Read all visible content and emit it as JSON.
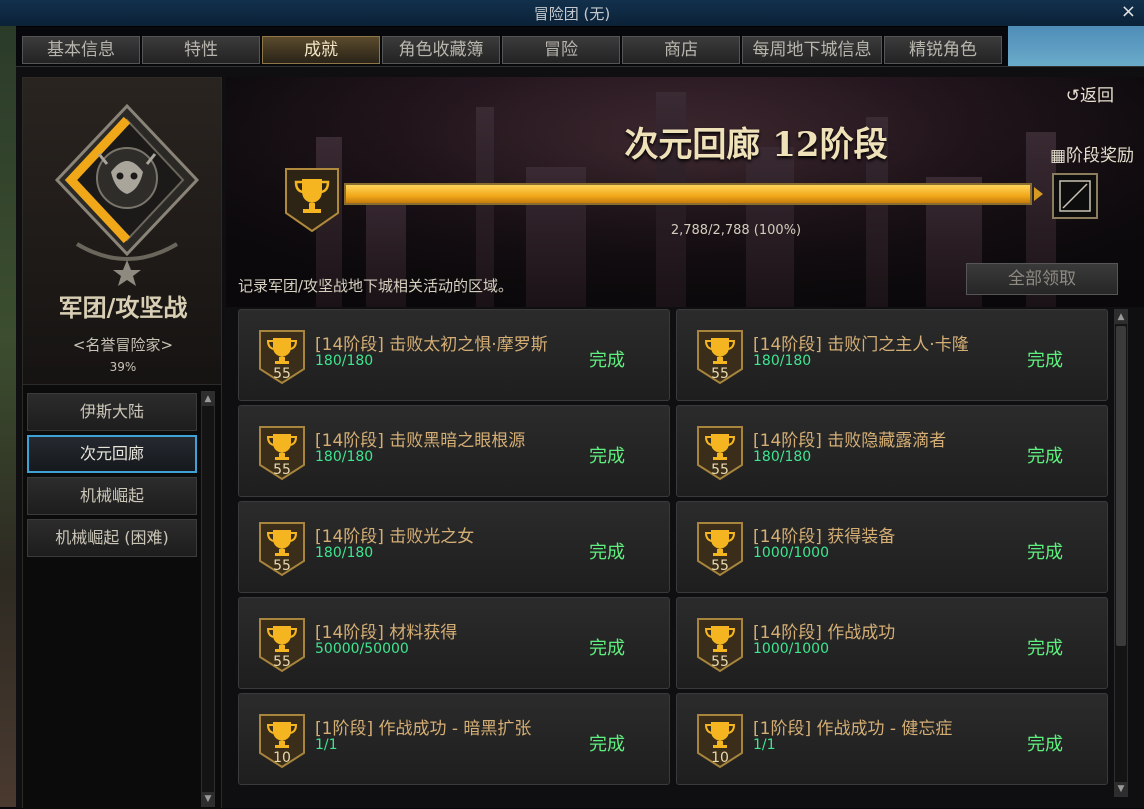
{
  "window": {
    "title": "冒险团 (无)",
    "close_label": "×"
  },
  "tabs": [
    {
      "label": "基本信息",
      "active": false
    },
    {
      "label": "特性",
      "active": false
    },
    {
      "label": "成就",
      "active": true
    },
    {
      "label": "角色收藏簿",
      "active": false
    },
    {
      "label": "冒险",
      "active": false
    },
    {
      "label": "商店",
      "active": false
    },
    {
      "label": "每周地下城信息",
      "active": false
    },
    {
      "label": "精锐角色",
      "active": false
    }
  ],
  "left_panel": {
    "dungeon_name": "军团/攻坚战",
    "rank_title": "<名誉冒险家>",
    "rank_percent": "39%",
    "areas": [
      {
        "label": "伊斯大陆",
        "active": false
      },
      {
        "label": "次元回廊",
        "active": true
      },
      {
        "label": "机械崛起",
        "active": false
      },
      {
        "label": "机械崛起 (困难)",
        "active": false
      }
    ]
  },
  "stage": {
    "title": "次元回廊 12阶段",
    "back_label": "返回",
    "reward_label": "阶段奖励",
    "progress_text": "2,788/2,788 (100%)",
    "progress_fraction": 1.0
  },
  "description": "记录军团/攻坚战地下城相关活动的区域。",
  "claim_all_label": "全部领取",
  "achievements": [
    {
      "level": "55",
      "name": "[14阶段] 击败太初之惧·摩罗斯",
      "count": "180/180",
      "status": "完成"
    },
    {
      "level": "55",
      "name": "[14阶段] 击败门之主人·卡隆",
      "count": "180/180",
      "status": "完成"
    },
    {
      "level": "55",
      "name": "[14阶段] 击败黑暗之眼根源",
      "count": "180/180",
      "status": "完成"
    },
    {
      "level": "55",
      "name": "[14阶段] 击败隐藏露滴者",
      "count": "180/180",
      "status": "完成"
    },
    {
      "level": "55",
      "name": "[14阶段] 击败光之女",
      "count": "180/180",
      "status": "完成"
    },
    {
      "level": "55",
      "name": "[14阶段] 获得装备",
      "count": "1000/1000",
      "status": "完成"
    },
    {
      "level": "55",
      "name": "[14阶段] 材料获得",
      "count": "50000/50000",
      "status": "完成"
    },
    {
      "level": "55",
      "name": "[14阶段] 作战成功",
      "count": "1000/1000",
      "status": "完成"
    },
    {
      "level": "10",
      "name": "[1阶段] 作战成功 - 暗黑扩张",
      "count": "1/1",
      "status": "完成"
    },
    {
      "level": "10",
      "name": "[1阶段] 作战成功 - 健忘症",
      "count": "1/1",
      "status": "完成"
    }
  ],
  "colors": {
    "accent_gold": "#f2a91a",
    "complete_green": "#5ef07e",
    "selected_blue": "#3ea2d6"
  },
  "icons": {
    "back": "return-arrow-icon",
    "reward": "gift-icon",
    "trophy": "trophy-icon",
    "emblem": "demon-skull-icon"
  }
}
